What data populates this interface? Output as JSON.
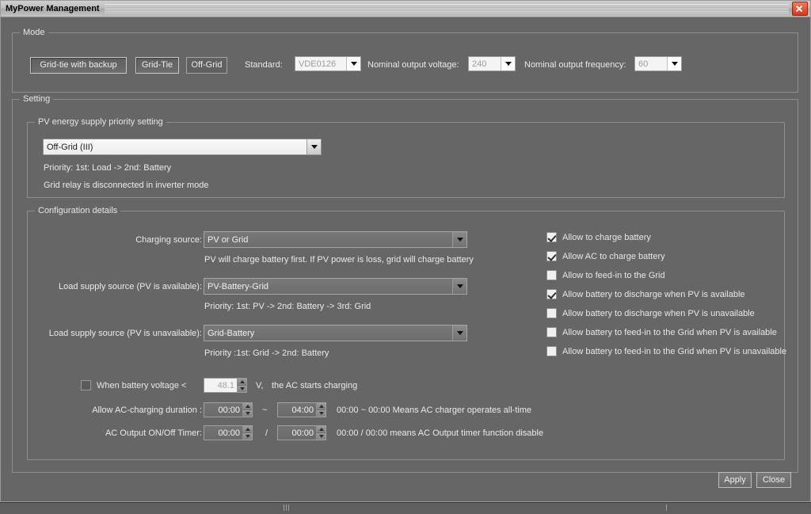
{
  "window": {
    "title": "MyPower Management",
    "close_icon": "close-icon"
  },
  "mode": {
    "legend": "Mode",
    "buttons": [
      {
        "label": "Grid-tie with backup",
        "state": "raised"
      },
      {
        "label": "Grid-Tie",
        "state": "raised"
      },
      {
        "label": "Off-Grid",
        "state": "selected"
      }
    ],
    "standard": {
      "label": "Standard:",
      "value": "VDE0126"
    },
    "nominal_voltage": {
      "label": "Nominal output voltage:",
      "value": "240"
    },
    "nominal_frequency": {
      "label": "Nominal output frequency:",
      "value": "60"
    }
  },
  "setting": {
    "legend": "Setting",
    "pv_priority": {
      "legend": "PV energy supply priority setting",
      "value": "Off-Grid (III)",
      "note1": "Priority: 1st: Load -> 2nd: Battery",
      "note2": "Grid relay is disconnected in inverter mode"
    },
    "config": {
      "legend": "Configuration details",
      "charging_source": {
        "label": "Charging source:",
        "value": "PV or Grid",
        "note": "PV will charge battery first. If PV power is loss, grid will charge battery"
      },
      "load_pv_available": {
        "label": "Load supply source (PV is available):",
        "value": "PV-Battery-Grid",
        "note": "Priority: 1st: PV -> 2nd: Battery -> 3rd: Grid"
      },
      "load_pv_unavailable": {
        "label": "Load supply source (PV is unavailable):",
        "value": "Grid-Battery",
        "note": "Priority :1st: Grid -> 2nd: Battery"
      },
      "checkboxes": [
        {
          "label": "Allow to charge battery",
          "checked": true
        },
        {
          "label": "Allow AC to charge battery",
          "checked": true
        },
        {
          "label": "Allow to feed-in to the Grid",
          "checked": false
        },
        {
          "label": "Allow battery to discharge when PV is available",
          "checked": true
        },
        {
          "label": "Allow battery to discharge when PV is unavailable",
          "checked": false
        },
        {
          "label": "Allow battery to feed-in to the Grid when PV is available",
          "checked": false
        },
        {
          "label": "Allow battery to feed-in to the Grid when PV is unavailable",
          "checked": false
        }
      ],
      "battery_voltage": {
        "checked": false,
        "label": "When battery voltage <",
        "value": "48.1",
        "unit": "V,",
        "suffix": "the AC starts charging"
      },
      "ac_charging_duration": {
        "label": "Allow AC-charging duration :",
        "from": "00:00",
        "separator": "~",
        "to": "04:00",
        "note": "00:00  ~  00:00 Means AC charger operates all-time"
      },
      "ac_output_timer": {
        "label": "AC Output ON/Off Timer:",
        "from": "00:00",
        "separator": "/",
        "to": "00:00",
        "note": "00:00 / 00:00 means AC Output timer function disable"
      }
    }
  },
  "footer": {
    "apply_label": "Apply",
    "close_label": "Close"
  }
}
